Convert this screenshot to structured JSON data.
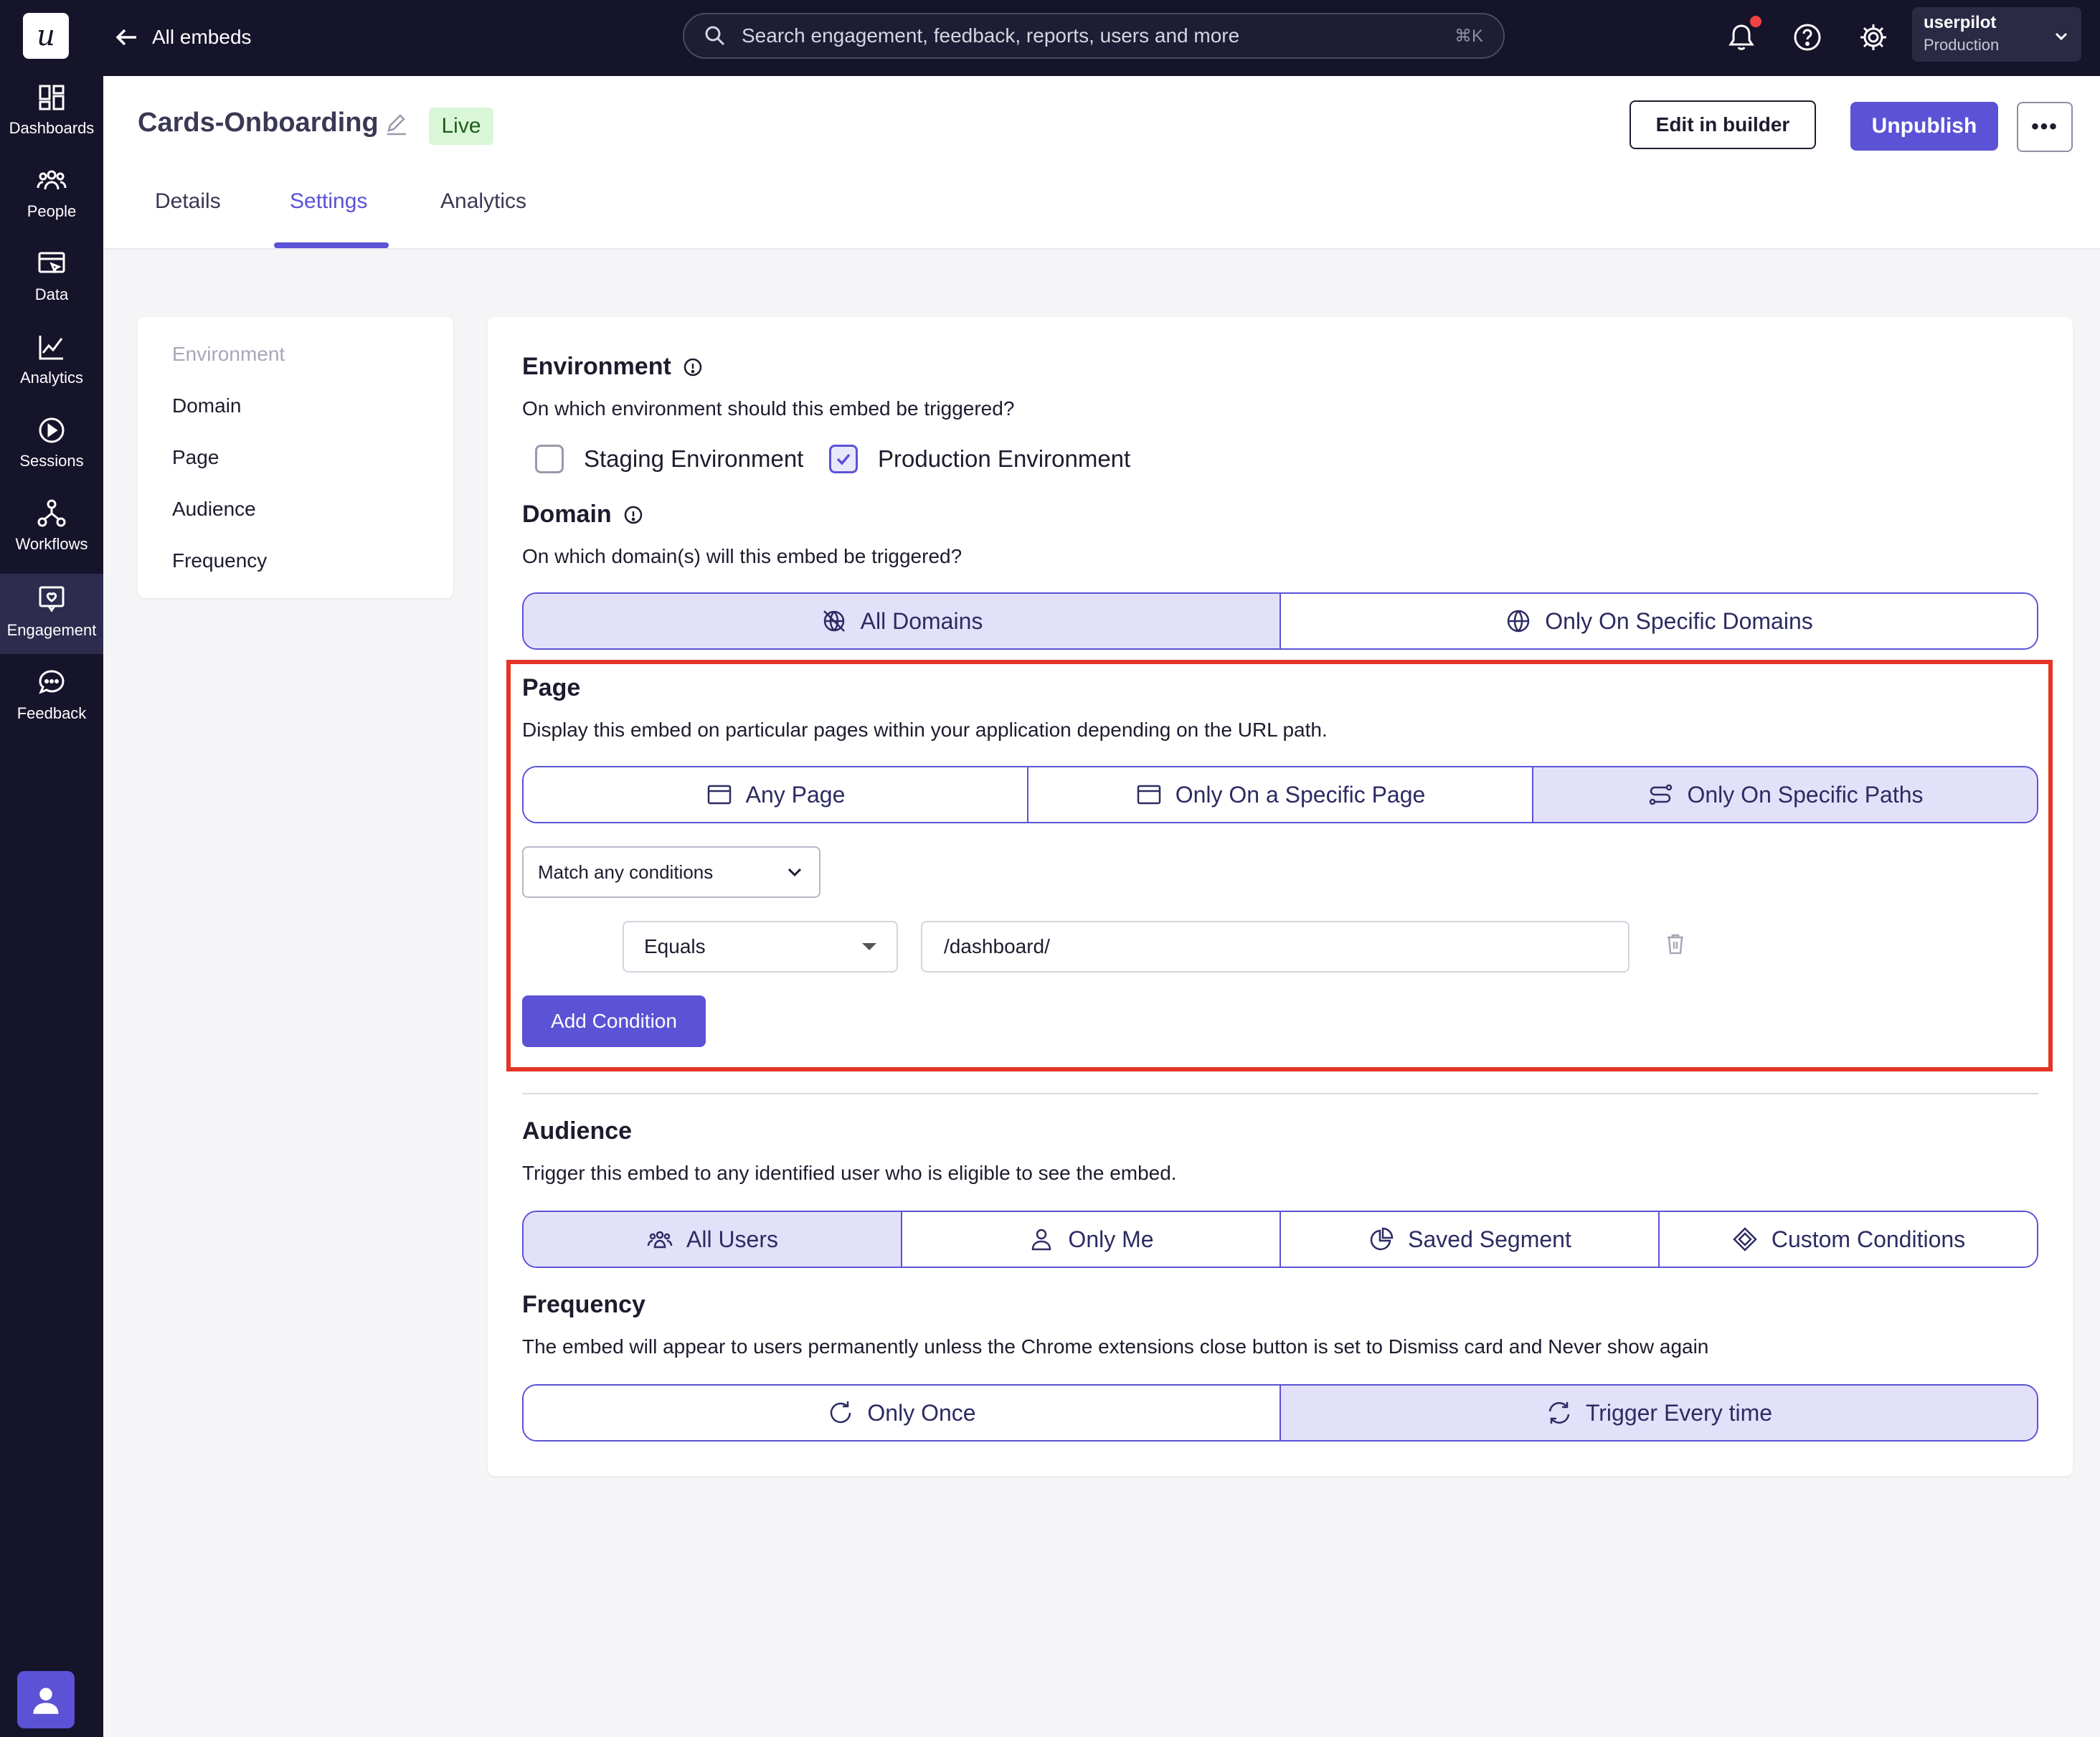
{
  "rail": {
    "logo": "u",
    "items": [
      {
        "label": "Dashboards",
        "icon": "dashboard-icon"
      },
      {
        "label": "People",
        "icon": "people-icon"
      },
      {
        "label": "Data",
        "icon": "data-icon"
      },
      {
        "label": "Analytics",
        "icon": "analytics-icon"
      },
      {
        "label": "Sessions",
        "icon": "play-icon"
      },
      {
        "label": "Workflows",
        "icon": "workflow-icon"
      },
      {
        "label": "Engagement",
        "icon": "engagement-icon",
        "active": true
      },
      {
        "label": "Feedback",
        "icon": "chat-icon"
      }
    ]
  },
  "topbar": {
    "back_label": "All embeds",
    "search_placeholder": "Search engagement, feedback, reports, users and more",
    "search_shortcut": "⌘K",
    "account_name": "userpilot",
    "account_env": "Production"
  },
  "header": {
    "title": "Cards-Onboarding",
    "status": "Live",
    "edit_label": "Edit in builder",
    "unpublish_label": "Unpublish",
    "more_label": "•••",
    "tabs": [
      "Details",
      "Settings",
      "Analytics"
    ],
    "active_tab": "Settings"
  },
  "sidenav": {
    "items": [
      "Environment",
      "Domain",
      "Page",
      "Audience",
      "Frequency"
    ]
  },
  "environment": {
    "title": "Environment",
    "desc": "On which environment should this embed be triggered?",
    "options": [
      {
        "label": "Staging Environment",
        "checked": false
      },
      {
        "label": "Production Environment",
        "checked": true
      }
    ]
  },
  "domain": {
    "title": "Domain",
    "desc": "On which domain(s) will this embed be triggered?",
    "options": [
      "All Domains",
      "Only On Specific Domains"
    ],
    "selected": "All Domains"
  },
  "page": {
    "title": "Page",
    "desc": "Display this embed on particular pages within your application depending on the URL path.",
    "options": [
      "Any Page",
      "Only On a Specific Page",
      "Only On Specific Paths"
    ],
    "selected": "Only On Specific Paths",
    "match_label": "Match any conditions",
    "condition_operator": "Equals",
    "condition_value": "/dashboard/",
    "add_label": "Add Condition"
  },
  "audience": {
    "title": "Audience",
    "desc": "Trigger this embed to any identified user who is eligible to see the embed.",
    "options": [
      "All Users",
      "Only Me",
      "Saved Segment",
      "Custom Conditions"
    ],
    "selected": "All Users"
  },
  "frequency": {
    "title": "Frequency",
    "desc": "The embed will appear to users permanently unless the Chrome extensions close button is set to Dismiss card and Never show again",
    "options": [
      "Only Once",
      "Trigger Every time"
    ],
    "selected": "Trigger Every time"
  },
  "colors": {
    "accent": "#5b52d6",
    "rail_bg": "#15142b",
    "highlight_box": "#e53325",
    "selected_segment": "#e3e1f9"
  }
}
